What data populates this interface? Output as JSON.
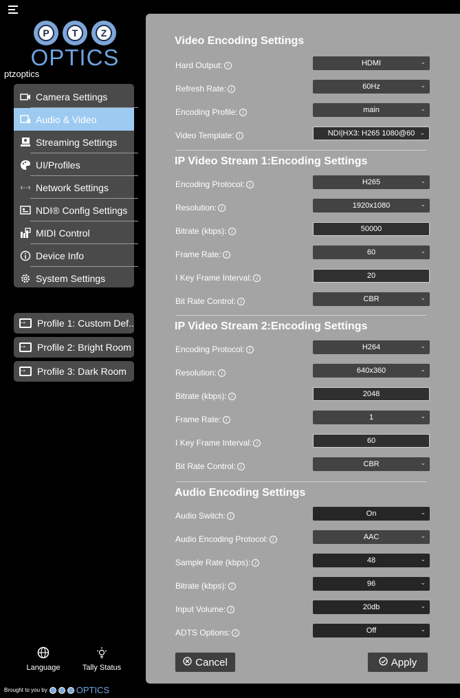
{
  "sidebar": {
    "brand_word": "OPTICS",
    "brand_letters": [
      "P",
      "T",
      "Z"
    ],
    "brand_sub": "ptzoptics",
    "nav": [
      {
        "label": "Camera Settings",
        "icon": "camera-icon"
      },
      {
        "label": "Audio & Video",
        "icon": "audio-video-icon",
        "active": true
      },
      {
        "label": "Streaming Settings",
        "icon": "streaming-icon"
      },
      {
        "label": "UI/Profiles",
        "icon": "palette-icon"
      },
      {
        "label": "Network Settings",
        "icon": "network-icon"
      },
      {
        "label": "NDI® Config Settings",
        "icon": "ndi-icon"
      },
      {
        "label": "MIDI Control",
        "icon": "midi-icon"
      },
      {
        "label": "Device Info",
        "icon": "info-icon"
      },
      {
        "label": "System Settings",
        "icon": "gear-icon"
      }
    ],
    "profiles": [
      {
        "label": "Profile 1: Custom Def.."
      },
      {
        "label": "Profile 2: Bright Room"
      },
      {
        "label": "Profile 3: Dark Room"
      }
    ],
    "language_label": "Language",
    "tally_label": "Tally Status",
    "brought_label": "Brought to you by",
    "brought_word": "OPTICS"
  },
  "main": {
    "sections": {
      "video": "Video Encoding Settings",
      "stream1": "IP Video Stream 1:Encoding Settings",
      "stream2": "IP Video Stream 2:Encoding Settings",
      "audio": "Audio Encoding Settings"
    },
    "rows": [
      {
        "label": "Hard Output:",
        "value": "HDMI"
      },
      {
        "label": "Refresh Rate:",
        "value": "60Hz"
      },
      {
        "label": "Encoding Profile:",
        "value": "main"
      },
      {
        "label": "Video Template:",
        "value": "NDI|HX3: H265 1080@60"
      },
      {
        "label": "Encoding Protocol:",
        "value": "H265"
      },
      {
        "label": "Resolution:",
        "value": "1920x1080"
      },
      {
        "label": "Bitrate (kbps):",
        "value": "50000"
      },
      {
        "label": "Frame Rate:",
        "value": "60"
      },
      {
        "label": "I Key Frame Interval:",
        "value": "20"
      },
      {
        "label": "Bit Rate Control:",
        "value": "CBR"
      },
      {
        "label": "Encoding Protocol:",
        "value": "H264"
      },
      {
        "label": "Resolution:",
        "value": "640x360"
      },
      {
        "label": "Bitrate (kbps):",
        "value": "2048"
      },
      {
        "label": "Frame Rate:",
        "value": "1"
      },
      {
        "label": "I Key Frame Interval:",
        "value": "60"
      },
      {
        "label": "Bit Rate Control:",
        "value": "CBR"
      },
      {
        "label": "Audio Switch:",
        "value": "On"
      },
      {
        "label": "Audio Encoding Protocol:",
        "value": "AAC"
      },
      {
        "label": "Sample Rate (kbps):",
        "value": "48"
      },
      {
        "label": "Bitrate (kbps):",
        "value": "96"
      },
      {
        "label": "Input Volume:",
        "value": "20db"
      },
      {
        "label": "ADTS Options:",
        "value": "Off"
      }
    ],
    "cancel_label": "Cancel",
    "apply_label": "Apply"
  }
}
